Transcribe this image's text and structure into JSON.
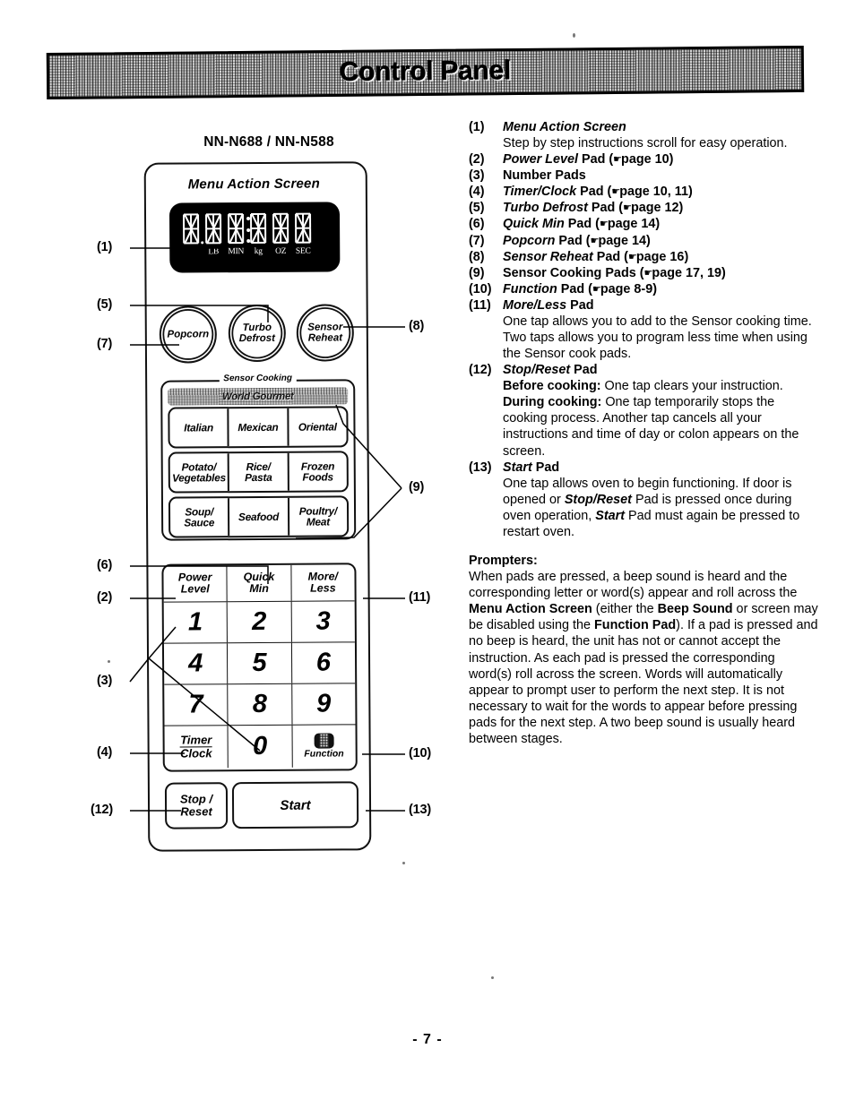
{
  "header": {
    "title": "Control Panel"
  },
  "footer": {
    "page": "- 7 -"
  },
  "diagram": {
    "model_label": "NN-N688 / NN-N588",
    "menu_action_screen_label": "Menu Action Screen",
    "display": {
      "unit_labels": [
        "",
        "LB",
        "MIN",
        "kg",
        "OZ",
        "SEC"
      ],
      "digit_count": 6
    },
    "round_buttons": [
      {
        "line1": "Popcorn",
        "line2": ""
      },
      {
        "line1": "Turbo",
        "line2": "Defrost"
      },
      {
        "line1": "Sensor",
        "line2": "Reheat"
      }
    ],
    "sensor_group": {
      "legend": "Sensor Cooking",
      "banner": "World Gourmet",
      "rows": [
        [
          {
            "line1": "Italian",
            "line2": ""
          },
          {
            "line1": "Mexican",
            "line2": ""
          },
          {
            "line1": "Oriental",
            "line2": ""
          }
        ],
        [
          {
            "line1": "Potato/",
            "line2": "Vegetables"
          },
          {
            "line1": "Rice/",
            "line2": "Pasta"
          },
          {
            "line1": "Frozen",
            "line2": "Foods"
          }
        ],
        [
          {
            "line1": "Soup/",
            "line2": "Sauce"
          },
          {
            "line1": "Seafood",
            "line2": ""
          },
          {
            "line1": "Poultry/",
            "line2": "Meat"
          }
        ]
      ]
    },
    "control_rows": {
      "top": [
        {
          "line1": "Power",
          "line2": "Level"
        },
        {
          "line1": "Quick",
          "line2": "Min"
        },
        {
          "line1": "More/",
          "line2": "Less"
        }
      ],
      "numbers": [
        [
          "1",
          "2",
          "3"
        ],
        [
          "4",
          "5",
          "6"
        ],
        [
          "7",
          "8",
          "9"
        ]
      ],
      "bottom": {
        "timer_line1": "Timer",
        "timer_line2": "Clock",
        "zero": "0",
        "function_label": "Function",
        "function_icon": "function-pad-icon"
      }
    },
    "stop_button": {
      "line1": "Stop /",
      "line2": "Reset"
    },
    "start_button": {
      "label": "Start"
    },
    "callouts": [
      "(1)",
      "(2)",
      "(3)",
      "(4)",
      "(5)",
      "(6)",
      "(7)",
      "(8)",
      "(9)",
      "(10)",
      "(11)",
      "(12)",
      "(13)"
    ]
  },
  "list": [
    {
      "num": "(1)",
      "title_italic": "Menu Action Screen",
      "title_rest": "",
      "desc": "Step by step instructions scroll for easy operation."
    },
    {
      "num": "(2)",
      "title_italic": "Power Level",
      "title_rest": " Pad (",
      "ref": "page 10",
      "close": ")"
    },
    {
      "num": "(3)",
      "title_italic": "",
      "title_rest": "Number Pads"
    },
    {
      "num": "(4)",
      "title_italic": "Timer/Clock",
      "title_rest": " Pad (",
      "ref": "page 10, 11",
      "close": ")"
    },
    {
      "num": "(5)",
      "title_italic": "Turbo Defrost",
      "title_rest": " Pad (",
      "ref": "page 12",
      "close": ")"
    },
    {
      "num": "(6)",
      "title_italic": "Quick Min",
      "title_rest": " Pad (",
      "ref": "page 14",
      "close": ")"
    },
    {
      "num": "(7)",
      "title_italic": "Popcorn",
      "title_rest": " Pad (",
      "ref": "page 14",
      "close": ")"
    },
    {
      "num": "(8)",
      "title_italic": "Sensor Reheat",
      "title_rest": " Pad (",
      "ref": "page 16",
      "close": ")"
    },
    {
      "num": "(9)",
      "title_italic": "",
      "title_rest": "Sensor Cooking Pads (",
      "ref": "page 17, 19",
      "close": ")"
    },
    {
      "num": "(10)",
      "title_italic": "Function",
      "title_rest": " Pad (",
      "ref": "page 8-9",
      "close": ")"
    },
    {
      "num": "(11)",
      "title_italic": "More/Less",
      "title_rest": " Pad",
      "desc": "One tap allows you to add to the Sensor cooking time. Two taps allows you to program less time when using the Sensor cook pads."
    },
    {
      "num": "(12)",
      "title_italic": "Stop/Reset",
      "title_rest": " Pad",
      "desc_before_label": "Before cooking:",
      "desc_before_text": " One tap clears your instruction.",
      "desc_during_label": "During cooking:",
      "desc_during_text": " One tap temporarily stops the cooking process. Another tap cancels all your instructions and time of day or colon appears on the screen."
    },
    {
      "num": "(13)",
      "title_italic": "Start",
      "title_rest": " Pad",
      "desc_p1": "One tap allows oven to begin functioning. If door is opened or ",
      "desc_i1": "Stop/Reset",
      "desc_p2": " Pad is pressed once during oven operation, ",
      "desc_i2": "Start",
      "desc_p3": " Pad must again be pressed to restart oven."
    }
  ],
  "prompters": {
    "heading": "Prompters:",
    "p1": "When pads are pressed, a beep sound is heard and the corresponding letter or word(s) appear and roll across the ",
    "b1": "Menu Action Screen",
    "p2": " (either the ",
    "b2": "Beep Sound",
    "p3": " or screen may be disabled using the ",
    "b3": "Function Pad",
    "p4": "). If a pad is pressed and no beep is heard, the unit has not or cannot accept the instruction. As each pad is pressed the corresponding word(s) roll across the screen. Words will automatically appear to prompt user to perform the next step. It is not necessary to wait for the words to appear before pressing pads for the next step. A two beep sound is usually heard between stages."
  }
}
